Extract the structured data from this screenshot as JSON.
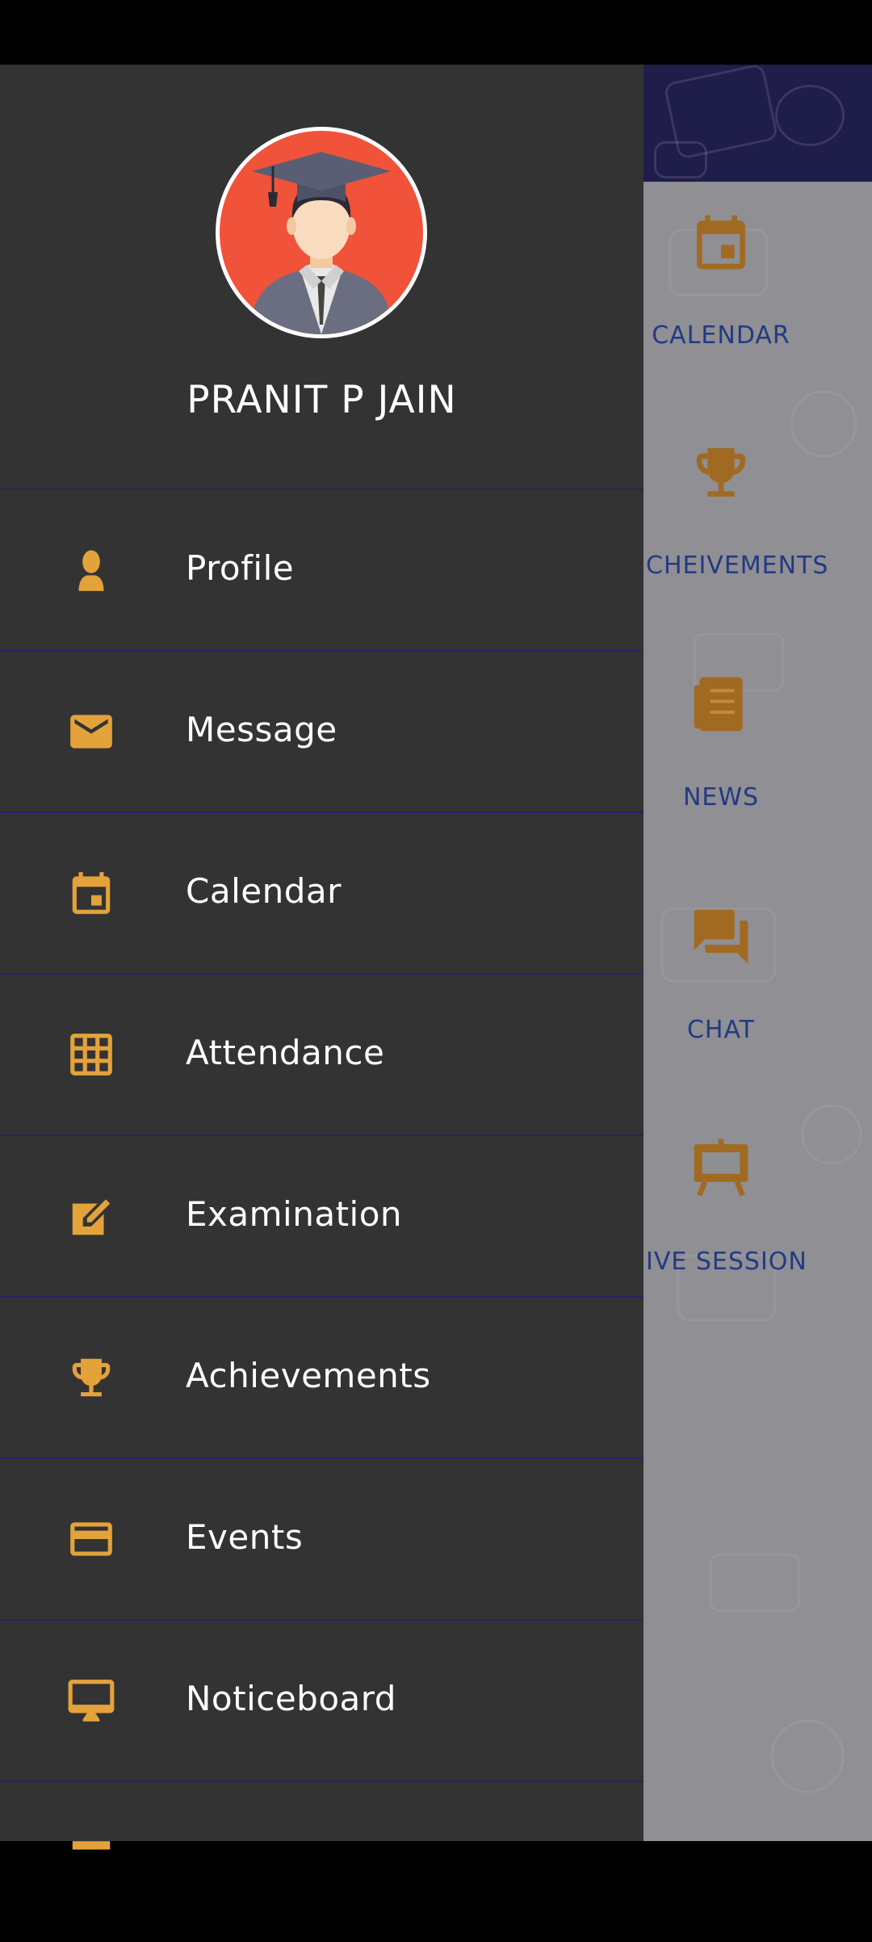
{
  "user": {
    "name": "PRANIT P JAIN"
  },
  "menu": [
    {
      "label": "Profile",
      "icon": "person-icon"
    },
    {
      "label": "Message",
      "icon": "envelope-icon"
    },
    {
      "label": "Calendar",
      "icon": "calendar-icon"
    },
    {
      "label": "Attendance",
      "icon": "grid-icon"
    },
    {
      "label": "Examination",
      "icon": "edit-icon"
    },
    {
      "label": "Achievements",
      "icon": "trophy-icon"
    },
    {
      "label": "Events",
      "icon": "card-icon"
    },
    {
      "label": "Noticeboard",
      "icon": "monitor-icon"
    }
  ],
  "background_tiles": [
    {
      "label": "CALENDAR",
      "icon": "calendar-icon"
    },
    {
      "label": "CHEIVEMENTS",
      "icon": "trophy-icon"
    },
    {
      "label": "NEWS",
      "icon": "news-icon"
    },
    {
      "label": "CHAT",
      "icon": "chat-icon"
    },
    {
      "label": "IVE SESSION",
      "icon": "presentation-board-icon"
    }
  ],
  "colors": {
    "drawer_bg": "#333333",
    "accent_icon": "#e4a23b",
    "divider": "#25236b",
    "avatar_bg": "#f0533a",
    "header_bg": "#1f1d49",
    "tile_text": "#223a84",
    "tile_icon": "#a16a22"
  }
}
